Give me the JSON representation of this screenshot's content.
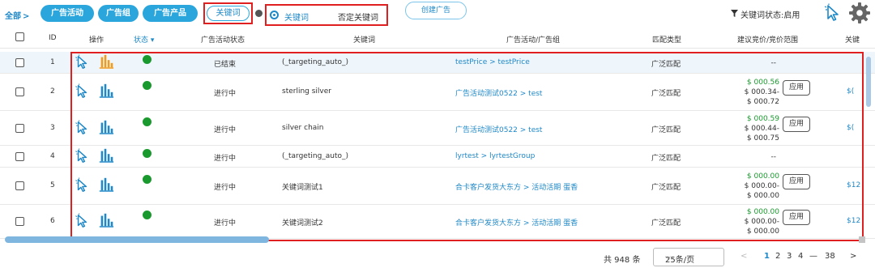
{
  "toolbar": {
    "breadcrumb": "全部",
    "breadcrumb_arrow": ">",
    "tabs": [
      "广告活动",
      "广告组",
      "广告产品",
      "关键词"
    ],
    "radio_keyword": "关键词",
    "radio_negative": "否定关键词",
    "create_button": "创建广告",
    "filter_text": "关键词状态:启用"
  },
  "table": {
    "headers": {
      "id": "ID",
      "action": "操作",
      "status": "状态",
      "campaign_status": "广告活动状态",
      "keyword": "关键词",
      "campaign_group": "广告活动/广告组",
      "match_type": "匹配类型",
      "bid_range": "建议竞价/竞价范围",
      "last": "关键"
    },
    "rows": [
      {
        "id": "1",
        "campaign_status": "已结束",
        "keyword": "(_targeting_auto_)",
        "campaign_group": "testPrice > testPrice",
        "match_type": "广泛匹配",
        "bid_lines": [
          "--"
        ],
        "apply": "",
        "edge": ""
      },
      {
        "id": "2",
        "campaign_status": "进行中",
        "keyword": "sterling silver",
        "campaign_group": "广告活动测试0522 > test",
        "match_type": "广泛匹配",
        "bid_lines": [
          "$ 000.56",
          "$ 000.34-",
          "$ 000.72"
        ],
        "apply": "应用",
        "edge": "$("
      },
      {
        "id": "3",
        "campaign_status": "进行中",
        "keyword": "silver chain",
        "campaign_group": "广告活动测试0522 > test",
        "match_type": "广泛匹配",
        "bid_lines": [
          "$ 000.59",
          "$ 000.44-",
          "$ 000.75"
        ],
        "apply": "应用",
        "edge": "$("
      },
      {
        "id": "4",
        "campaign_status": "进行中",
        "keyword": "(_targeting_auto_)",
        "campaign_group": "lyrtest > lyrtestGroup",
        "match_type": "广泛匹配",
        "bid_lines": [
          "--"
        ],
        "apply": "",
        "edge": ""
      },
      {
        "id": "5",
        "campaign_status": "进行中",
        "keyword": "关键词测试1",
        "campaign_group": "合卡客户发货大东方 > 活动活期 蛋香",
        "match_type": "广泛匹配",
        "bid_lines": [
          "$ 000.00",
          "$ 000.00-",
          "$ 000.00"
        ],
        "apply": "应用",
        "edge": "$12"
      },
      {
        "id": "6",
        "campaign_status": "进行中",
        "keyword": "关键词测试2",
        "campaign_group": "合卡客户发货大东方 > 活动活期 蛋香",
        "match_type": "广泛匹配",
        "bid_lines": [
          "$ 000.00",
          "$ 000.00-",
          "$ 000.00"
        ],
        "apply": "应用",
        "edge": "$12"
      }
    ]
  },
  "pagination": {
    "total": "共 948 条",
    "page_size": "25条/页",
    "prev": "<",
    "pages": [
      "1",
      "2",
      "3",
      "4",
      "—",
      "38"
    ],
    "current": "1",
    "next": ">"
  },
  "colors": {
    "accent": "#2aa6dc",
    "link": "#1e88c8",
    "status_active": "#1a9a2e",
    "highlight_border": "#e02020"
  }
}
